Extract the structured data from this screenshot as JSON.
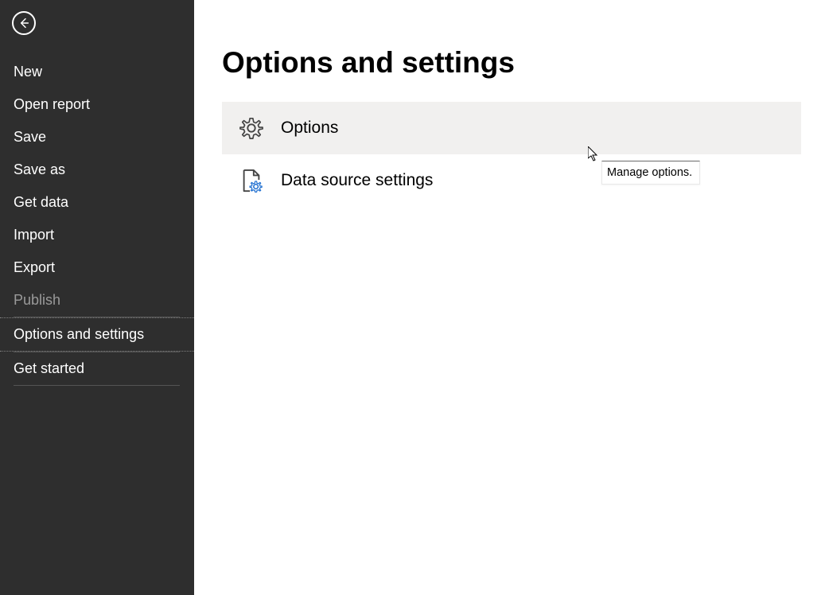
{
  "sidebar": {
    "items": [
      {
        "label": "New"
      },
      {
        "label": "Open report"
      },
      {
        "label": "Save"
      },
      {
        "label": "Save as"
      },
      {
        "label": "Get data"
      },
      {
        "label": "Import"
      },
      {
        "label": "Export"
      },
      {
        "label": "Publish"
      },
      {
        "label": "Options and settings"
      },
      {
        "label": "Get started"
      }
    ]
  },
  "page": {
    "title": "Options and settings"
  },
  "options": [
    {
      "label": "Options"
    },
    {
      "label": "Data source settings"
    }
  ],
  "tooltip": {
    "text": "Manage options."
  }
}
